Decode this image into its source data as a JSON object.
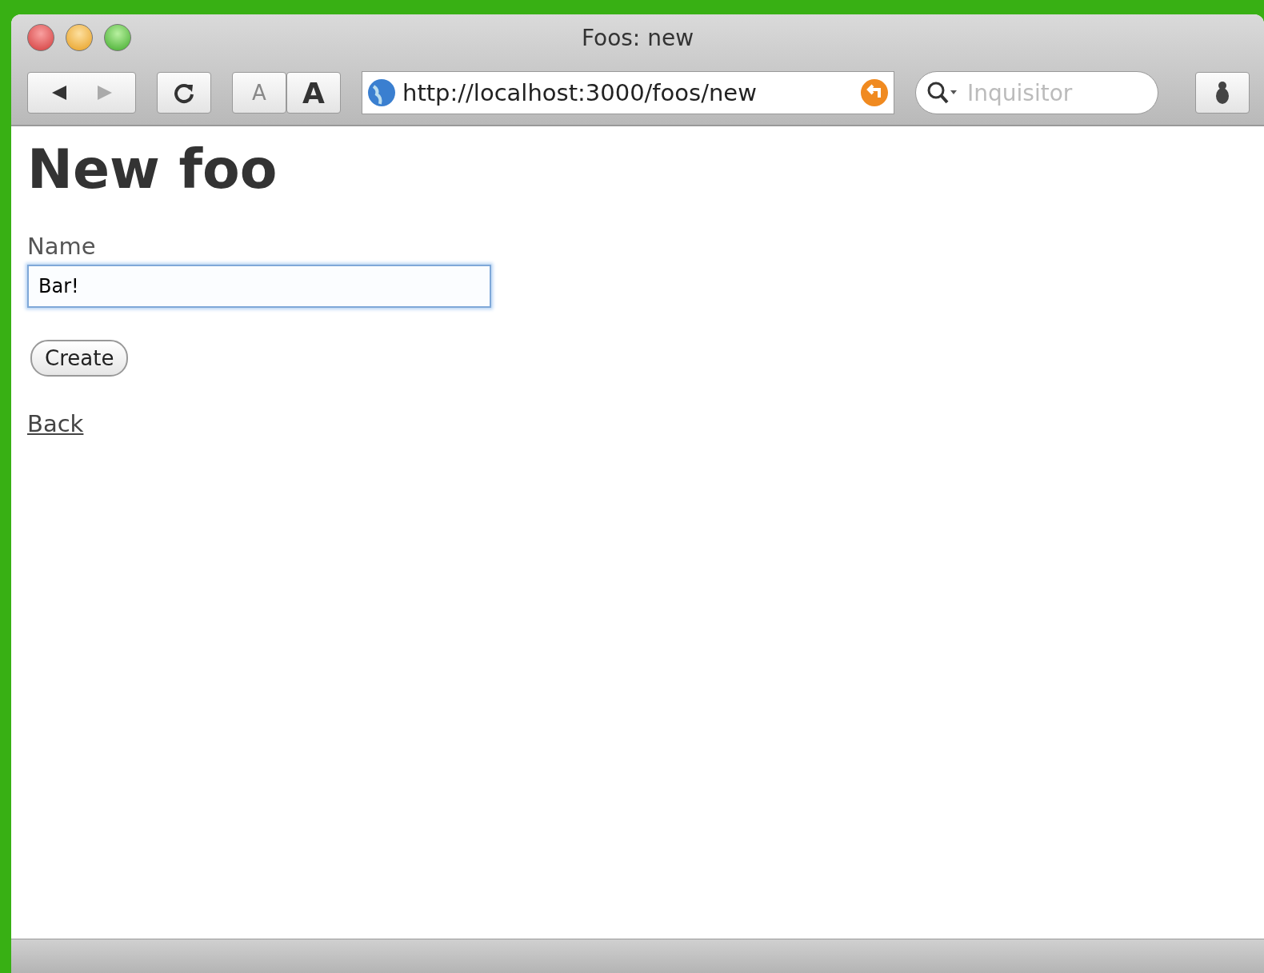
{
  "window": {
    "title": "Foos: new"
  },
  "toolbar": {
    "text_size_buttons": [
      "A",
      "A"
    ],
    "address": "http://localhost:3000/foos/new",
    "search": {
      "placeholder": "Inquisitor"
    }
  },
  "page": {
    "heading": "New foo",
    "field": {
      "label": "Name",
      "value": "Bar!",
      "focused": true
    },
    "submit": "Create",
    "link": "Back"
  }
}
